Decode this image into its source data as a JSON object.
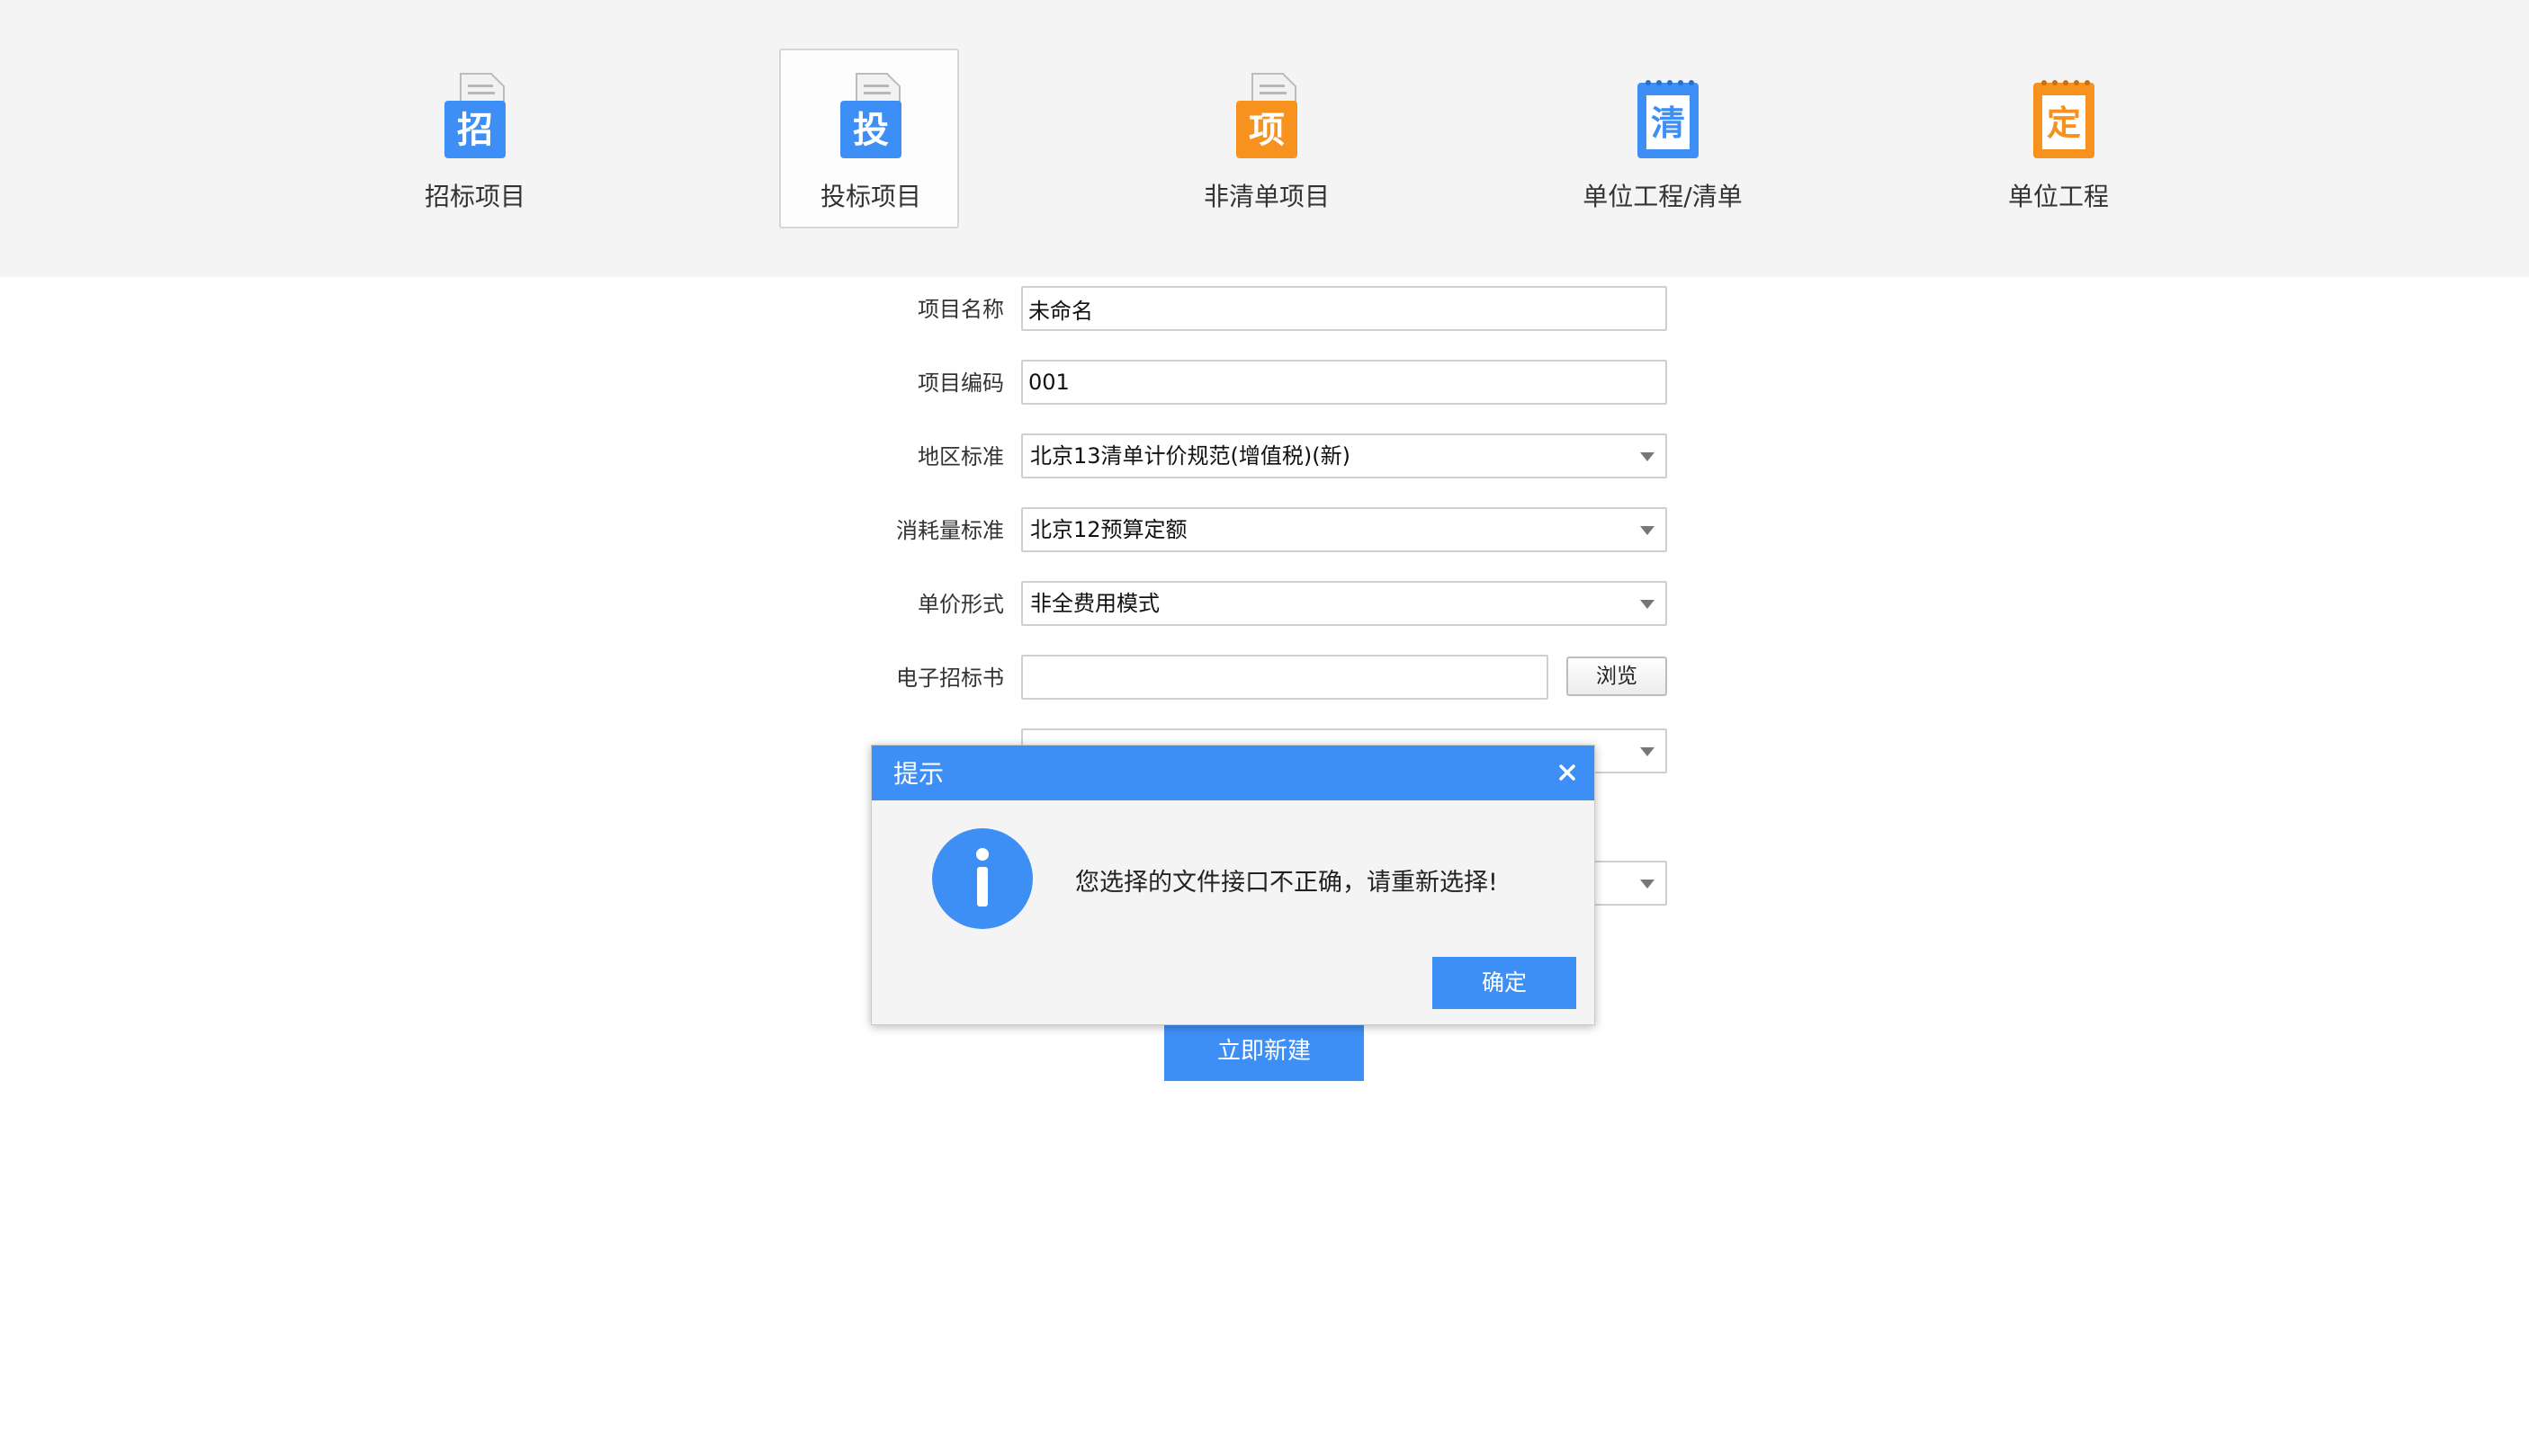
{
  "project_types": [
    {
      "label": "招标项目",
      "badge": "招",
      "color": "#3d8ff5"
    },
    {
      "label": "投标项目",
      "badge": "投",
      "color": "#3d8ff5"
    },
    {
      "label": "非清单项目",
      "badge": "项",
      "color": "#f7921e"
    },
    {
      "label": "单位工程/清单",
      "badge": "清",
      "color": "#3d8ff5"
    },
    {
      "label": "单位工程",
      "badge": "定",
      "color": "#f7921e"
    }
  ],
  "selected_type": "投标项目",
  "form": {
    "project_name": {
      "label": "项目名称",
      "value": "未命名"
    },
    "project_code": {
      "label": "项目编码",
      "value": "001"
    },
    "region_standard": {
      "label": "地区标准",
      "value": "北京13清单计价规范(增值税)(新)"
    },
    "consumption_standard": {
      "label": "消耗量标准",
      "value": "北京12预算定额"
    },
    "unit_price_form": {
      "label": "单价形式",
      "value": "非全费用模式"
    },
    "e_tender": {
      "label": "电子招标书",
      "value": "",
      "browse_label": "浏览"
    }
  },
  "create_button": "立即新建",
  "dialog": {
    "title": "提示",
    "message": "您选择的文件接口不正确，请重新选择!",
    "confirm_label": "确定"
  },
  "colors": {
    "accent": "#3d8ff5",
    "orange": "#f7921e",
    "topbar_bg": "#f4f4f4"
  }
}
